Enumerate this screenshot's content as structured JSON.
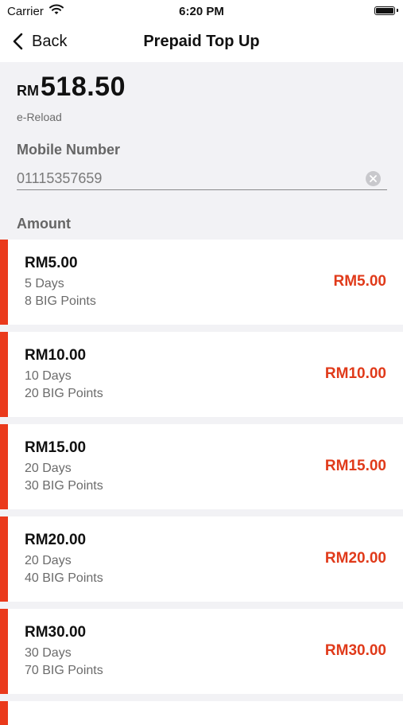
{
  "status_bar": {
    "carrier": "Carrier",
    "time": "6:20 PM"
  },
  "nav": {
    "back_label": "Back",
    "title": "Prepaid Top Up"
  },
  "balance": {
    "currency": "RM",
    "amount": "518.50",
    "type": "e-Reload"
  },
  "mobile": {
    "label": "Mobile Number",
    "value": "01115357659"
  },
  "amount_section": {
    "label": "Amount"
  },
  "accent_color": "#ea3a1c",
  "price_color": "#e03a1a",
  "topups": [
    {
      "title": "RM5.00",
      "days": "5 Days",
      "points": "8 BIG Points",
      "price": "RM5.00"
    },
    {
      "title": "RM10.00",
      "days": "10 Days",
      "points": "20 BIG Points",
      "price": "RM10.00"
    },
    {
      "title": "RM15.00",
      "days": "20 Days",
      "points": "30 BIG Points",
      "price": "RM15.00"
    },
    {
      "title": "RM20.00",
      "days": "20 Days",
      "points": "40 BIG Points",
      "price": "RM20.00"
    },
    {
      "title": "RM30.00",
      "days": "30 Days",
      "points": "70 BIG Points",
      "price": "RM30.00"
    }
  ]
}
